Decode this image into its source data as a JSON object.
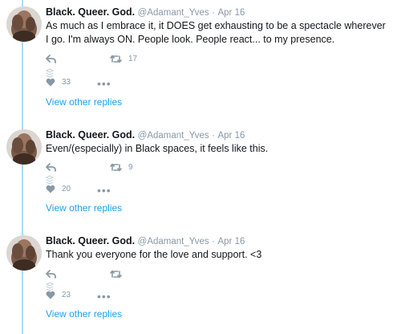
{
  "colors": {
    "accent": "#1da1f2",
    "thread_line": "#aadcf4",
    "muted": "#8899a6",
    "text": "#14171a"
  },
  "tweets": [
    {
      "name": "Black. Queer. God.",
      "handle": "@Adamant_Yves",
      "separator": "·",
      "time": "Apr 16",
      "text": "As much as I embrace it, it DOES get exhausting to be a spectacle wherever I go. I'm always ON. People look. People react... to my presence.",
      "retweets": "17",
      "likes": "33",
      "more": "•••",
      "view_replies": "View other replies"
    },
    {
      "name": "Black. Queer. God.",
      "handle": "@Adamant_Yves",
      "separator": "·",
      "time": "Apr 16",
      "text": "Even/(especially) in Black spaces, it feels like this.",
      "retweets": "9",
      "likes": "20",
      "more": "•••",
      "view_replies": "View other replies"
    },
    {
      "name": "Black. Queer. God.",
      "handle": "@Adamant_Yves",
      "separator": "·",
      "time": "Apr 16",
      "text": "Thank you everyone for the love and support. <3",
      "retweets": "",
      "likes": "23",
      "more": "•••",
      "view_replies": "View other replies"
    }
  ]
}
